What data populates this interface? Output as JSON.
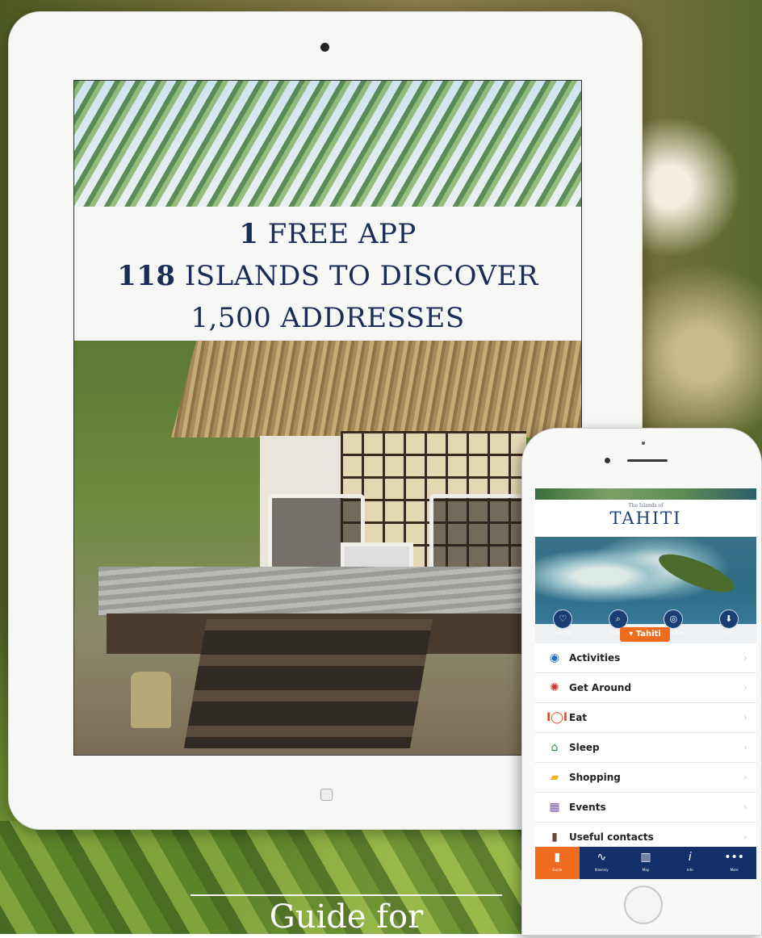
{
  "ipad": {
    "banner": {
      "line1_num": "1",
      "line1_text": "FREE APP",
      "line2_num": "118",
      "line2_text": "ISLANDS TO DISCOVER",
      "line3_text": "1,500 ADDRESSES"
    }
  },
  "phone": {
    "header": {
      "subtitle": "The Islands of",
      "title": "TAHITI"
    },
    "quick_actions": [
      {
        "icon": "heart-icon",
        "label": "FAVORITES"
      },
      {
        "icon": "search-icon",
        "label": "SEARCH"
      },
      {
        "icon": "compass-icon",
        "label": "AROUND ME"
      },
      {
        "icon": "download-icon",
        "label": "AIR"
      }
    ],
    "island_selector": "Tahiti",
    "menu_items": [
      {
        "icon": "eye-icon",
        "label": "Activities"
      },
      {
        "icon": "compass-icon",
        "label": "Get Around"
      },
      {
        "icon": "restaurant-icon",
        "label": "Eat"
      },
      {
        "icon": "bungalow-icon",
        "label": "Sleep"
      },
      {
        "icon": "shopping-bag-icon",
        "label": "Shopping"
      },
      {
        "icon": "calendar-icon",
        "label": "Events"
      },
      {
        "icon": "book-icon",
        "label": "Useful contacts"
      }
    ],
    "bottom_nav": [
      {
        "icon": "guide-icon",
        "label": "Guide",
        "active": true
      },
      {
        "icon": "itinerary-icon",
        "label": "Itinerary",
        "active": false
      },
      {
        "icon": "map-icon",
        "label": "Map",
        "active": false
      },
      {
        "icon": "info-icon",
        "label": "Info",
        "active": false
      },
      {
        "icon": "more-icon",
        "label": "More",
        "active": false
      }
    ]
  },
  "footer": {
    "text": "Guide for"
  },
  "colors": {
    "navy": "#1c2c5a",
    "orange": "#ef6b1e",
    "nav_blue": "#14306b"
  }
}
